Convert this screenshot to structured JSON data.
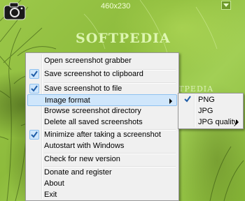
{
  "screenshot": {
    "dimensions_label": "460x230",
    "watermark": "SOFTPEDIA",
    "watermark_small": "SOFTPEDIA"
  },
  "toolbar": {
    "camera_icon": "camera-icon",
    "dropdown_icon": "chevron-down-icon"
  },
  "menu": {
    "items": [
      {
        "label": "Open screenshot grabber",
        "checked": false
      },
      {
        "label": "Save screenshot to clipboard",
        "checked": true
      },
      {
        "label": "Save screenshot to file",
        "checked": true
      },
      {
        "label": "Image format",
        "checked": false,
        "submenu": true,
        "highlighted": true
      },
      {
        "label": "Browse screenshot directory",
        "checked": false
      },
      {
        "label": "Delete all saved screenshots",
        "checked": false
      },
      {
        "label": "Minimize after taking a screenshot",
        "checked": true
      },
      {
        "label": "Autostart with Windows",
        "checked": false
      },
      {
        "label": "Check for new version",
        "checked": false
      },
      {
        "label": "Donate and register",
        "checked": false
      },
      {
        "label": "About",
        "checked": false
      },
      {
        "label": "Exit",
        "checked": false
      }
    ]
  },
  "submenu": {
    "items": [
      {
        "label": "PNG",
        "checked": true
      },
      {
        "label": "JPG",
        "checked": false
      },
      {
        "label": "JPG quality",
        "submenu": true
      }
    ]
  },
  "colors": {
    "highlight": "#cfe6fb",
    "highlight_border": "#8fc1f0",
    "check": "#1f5da8",
    "background_green": "#9cc84a"
  }
}
